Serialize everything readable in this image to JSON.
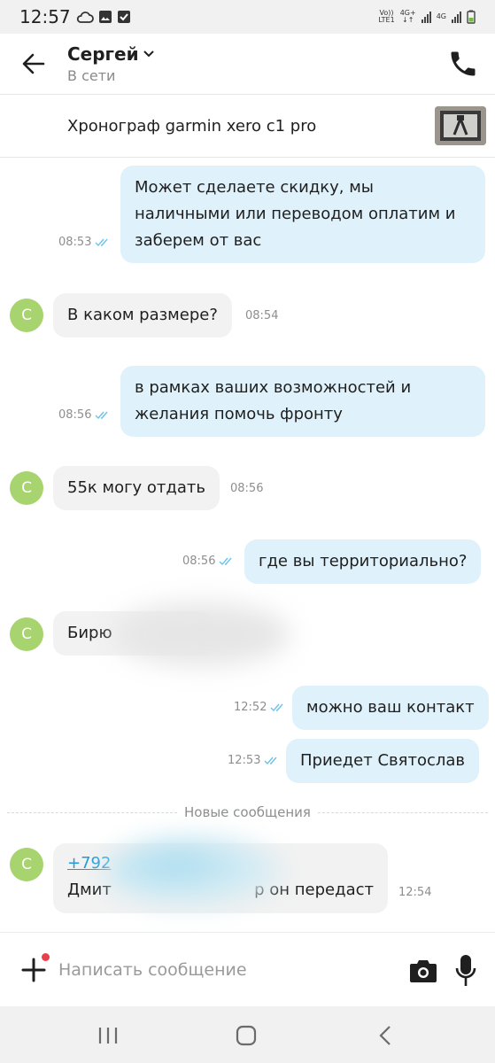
{
  "status_bar": {
    "time": "12:57",
    "net1_top": "Vo))",
    "net1_bottom": "LTE1",
    "net2_top": "4G+",
    "net2_bottom": "↓↑",
    "net3": "4G"
  },
  "header": {
    "contact_name": "Сергей",
    "contact_status": "В сети"
  },
  "product": {
    "title": "Хронограф garmin xero c1 pro"
  },
  "messages": [
    {
      "direction": "out",
      "text": "Может сделаете скидку, мы наличными или переводом оплатим и заберем от вас",
      "time": "08:53",
      "read": true
    },
    {
      "direction": "in",
      "avatar": "С",
      "text": "В каком размере?",
      "time": "08:54"
    },
    {
      "direction": "out",
      "text": "в рамках ваших возможностей и желания помочь фронту",
      "time": "08:56",
      "read": true
    },
    {
      "direction": "in",
      "avatar": "С",
      "text": "55к могу отдать",
      "time": "08:56"
    },
    {
      "direction": "out",
      "text": "где вы территориально?",
      "time": "08:56",
      "read": true
    },
    {
      "direction": "in",
      "avatar": "С",
      "text": "Бирю",
      "time": ""
    },
    {
      "direction": "out",
      "text": "можно ваш контакт",
      "time": "12:52",
      "read": true
    },
    {
      "direction": "out",
      "text": "Приедет Святослав",
      "time": "12:53",
      "read": true
    },
    {
      "direction": "in",
      "avatar": "С",
      "link_text": "+792",
      "text_line2_start": "Дмит",
      "text_line2_end": "р он передаст",
      "time": "12:54"
    }
  ],
  "divider_label": "Новые сообщения",
  "input": {
    "placeholder": "Написать сообщение"
  },
  "icons": {
    "back": "back-arrow-icon",
    "call": "phone-icon",
    "plus": "plus-icon",
    "camera": "camera-icon",
    "mic": "microphone-icon",
    "read": "double-check-icon"
  },
  "colors": {
    "outgoing_bubble": "#dff2fb",
    "incoming_bubble": "#f2f2f2",
    "avatar": "#a8d46f",
    "link": "#1f9ad6",
    "read_check": "#6cc3ea",
    "notification_dot": "#e9414a"
  }
}
